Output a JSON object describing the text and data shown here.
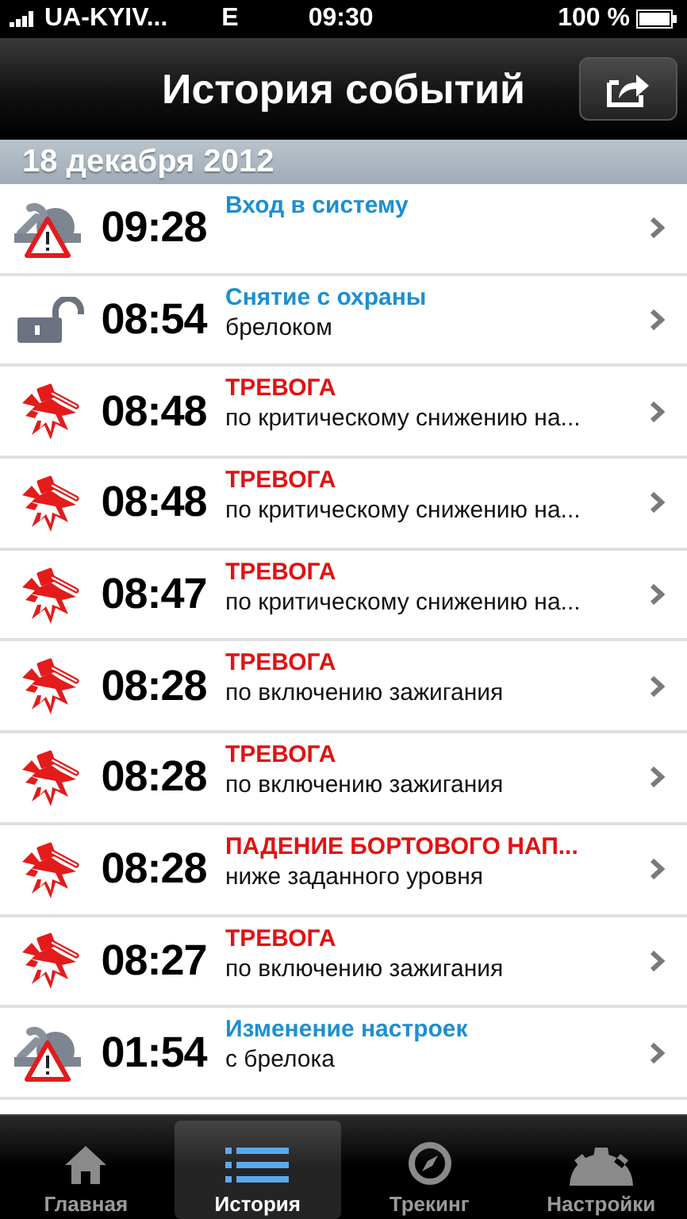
{
  "status_bar": {
    "carrier": "UA-KYIV...",
    "network": "E",
    "time": "09:30",
    "battery": "100 %"
  },
  "nav_bar": {
    "title": "История событий"
  },
  "date_header": "18 декабря 2012",
  "events": [
    {
      "kind": "settings",
      "time": "09:28",
      "title": "Вход в систему"
    },
    {
      "kind": "unlock",
      "time": "08:54",
      "title": "Снятие с охраны",
      "subtitle": "брелоком"
    },
    {
      "kind": "alarm",
      "time": "08:48",
      "title": "ТРЕВОГА",
      "subtitle": "по критическому снижению на..."
    },
    {
      "kind": "alarm",
      "time": "08:48",
      "title": "ТРЕВОГА",
      "subtitle": "по критическому снижению на..."
    },
    {
      "kind": "alarm",
      "time": "08:47",
      "title": "ТРЕВОГА",
      "subtitle": "по критическому снижению на..."
    },
    {
      "kind": "alarm",
      "time": "08:28",
      "title": "ТРЕВОГА",
      "subtitle": "по включению зажигания"
    },
    {
      "kind": "alarm",
      "time": "08:28",
      "title": "ТРЕВОГА",
      "subtitle": "по включению зажигания"
    },
    {
      "kind": "alarm",
      "time": "08:28",
      "title": "ПАДЕНИЕ БОРТОВОГО НАП...",
      "subtitle": "ниже заданного уровня"
    },
    {
      "kind": "alarm",
      "time": "08:27",
      "title": "ТРЕВОГА",
      "subtitle": "по включению зажигания"
    },
    {
      "kind": "settings",
      "time": "01:54",
      "title": "Изменение настроек",
      "subtitle": "с брелока"
    }
  ],
  "tabs": [
    {
      "kind": "home",
      "label": "Главная",
      "selected": false
    },
    {
      "kind": "list",
      "label": "История",
      "selected": true
    },
    {
      "kind": "compass",
      "label": "Трекинг",
      "selected": false
    },
    {
      "kind": "gear",
      "label": "Настройки",
      "selected": false
    }
  ]
}
